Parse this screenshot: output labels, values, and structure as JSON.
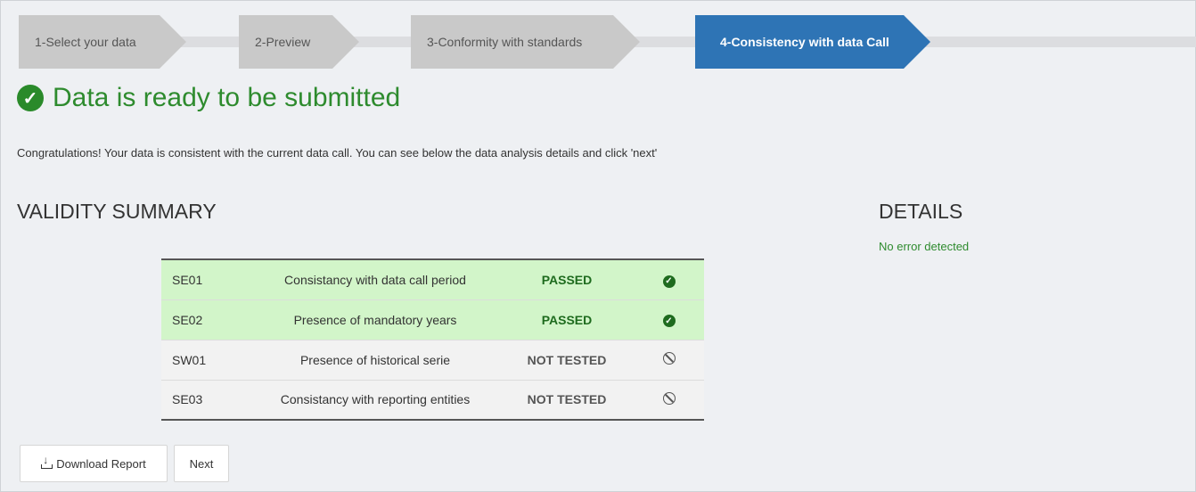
{
  "wizard": {
    "steps": [
      {
        "label": "1-Select your data"
      },
      {
        "label": "2-Preview"
      },
      {
        "label": "3-Conformity with standards"
      },
      {
        "label": "4-Consistency with data Call"
      }
    ]
  },
  "headline": {
    "text": "Data is ready to be submitted",
    "icon": "check-circle-icon"
  },
  "message": "Congratulations! Your data is consistent with the current data call. You can see below the data analysis details and click 'next'",
  "validity": {
    "title": "VALIDITY SUMMARY",
    "rows": [
      {
        "code": "SE01",
        "description": "Consistancy with data call period",
        "status": "PASSED",
        "icon": "check-circle-icon"
      },
      {
        "code": "SE02",
        "description": "Presence of mandatory years",
        "status": "PASSED",
        "icon": "check-circle-icon"
      },
      {
        "code": "SW01",
        "description": "Presence of historical serie",
        "status": "NOT TESTED",
        "icon": "ban-icon"
      },
      {
        "code": "SE03",
        "description": "Consistancy with reporting entities",
        "status": "NOT TESTED",
        "icon": "ban-icon"
      }
    ]
  },
  "details": {
    "title": "DETAILS",
    "message": "No error detected"
  },
  "buttons": {
    "download": "Download Report",
    "next": "Next"
  },
  "colors": {
    "active_step": "#2e74b5",
    "success": "#2e8b2e",
    "passed_row": "#d2f5c9"
  }
}
